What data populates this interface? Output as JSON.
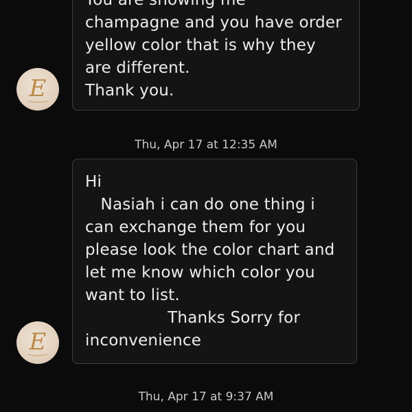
{
  "messages": [
    {
      "lines": [
        "You are showing me",
        "champagne and you have order",
        "yellow color that is why they",
        "are different.",
        "Thank you."
      ]
    },
    {
      "lines": [
        "Hi",
        "   Nasiah i can do one thing i",
        "can exchange them for you",
        "please look the color chart and",
        "let me know which color you",
        "want to list.",
        "                Thanks Sorry for",
        "inconvenience"
      ]
    }
  ],
  "timestamps": [
    "Thu, Apr 17 at 12:35 AM",
    "Thu, Apr 17 at 9:37 AM"
  ],
  "avatar": {
    "icon": "monogram-e-logo",
    "letter": "E",
    "colors": {
      "background": "#e2d1be",
      "letter": "#b98a4a"
    }
  }
}
